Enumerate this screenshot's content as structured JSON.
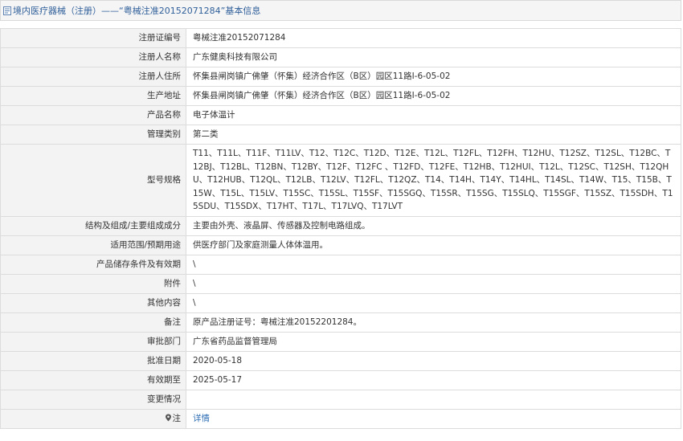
{
  "header": {
    "title": "境内医疗器械（注册）——“粤械注准20152071284”基本信息"
  },
  "rows": [
    {
      "label": "注册证编号",
      "value": "粤械注准20152071284"
    },
    {
      "label": "注册人名称",
      "value": "广东健奥科技有限公司"
    },
    {
      "label": "注册人住所",
      "value": "怀集县闸岗镇广佛肇（怀集）经济合作区（B区）园区11路I-6-05-02"
    },
    {
      "label": "生产地址",
      "value": "怀集县闸岗镇广佛肇（怀集）经济合作区（B区）园区11路I-6-05-02"
    },
    {
      "label": "产品名称",
      "value": "电子体温计"
    },
    {
      "label": "管理类别",
      "value": "第二类"
    },
    {
      "label": "型号规格",
      "value": "T11、T11L、T11F、T11LV、T12、T12C、T12D、T12E、T12L、T12FL、T12FH、T12HU、T12SZ、T12SL、T12BC、T12BJ、T12BL、T12BN、T12BY、T12F、T12FC 、T12FD、T12FE、T12HB、T12HUI、T12L、T12SC、T12SH、T12QHU、T12HUB、T12QL、T12LB、T12LV、T12FL、T12QZ、T14、T14H、T14Y、T14HL、T14SL、T14W、T15、T15B、T15W、T15L、T15LV、T15SC、T15SL、T15SF、T15SGQ、T15SR、T15SG、T15SLQ、T15SGF、T15SZ、T15SDH、T15SDU、T15SDX、T17HT、T17L、T17LVQ、T17LVT"
    },
    {
      "label": "结构及组成/主要组成成分",
      "value": "主要由外壳、液晶屏、传感器及控制电路组成。"
    },
    {
      "label": "适用范围/预期用途",
      "value": "供医疗部门及家庭测量人体体温用。"
    },
    {
      "label": "产品储存条件及有效期",
      "value": "\\"
    },
    {
      "label": "附件",
      "value": "\\"
    },
    {
      "label": "其他内容",
      "value": "\\"
    },
    {
      "label": "备注",
      "value": "原产品注册证号：粤械注准20152201284。"
    },
    {
      "label": "审批部门",
      "value": "广东省药品监督管理局"
    },
    {
      "label": "批准日期",
      "value": "2020-05-18"
    },
    {
      "label": "有效期至",
      "value": "2025-05-17"
    },
    {
      "label": "变更情况",
      "value": ""
    },
    {
      "label": "注",
      "value": "详情"
    }
  ],
  "icons": {
    "header_icon": "document-icon",
    "note_icon": "map-pin-icon",
    "accent_color": "#2f5f9a",
    "link_color": "#2f6fb5"
  }
}
